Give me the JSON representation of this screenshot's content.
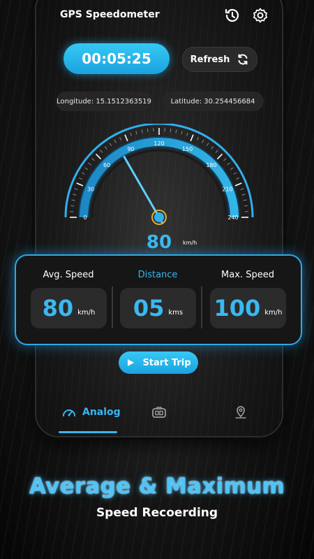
{
  "app": {
    "title": "GPS Speedometer"
  },
  "header": {
    "history_icon": "history-icon",
    "settings_icon": "gear-icon"
  },
  "timer": {
    "value": "00:05:25"
  },
  "refresh": {
    "label": "Refresh",
    "icon": "refresh-icon"
  },
  "location": {
    "longitude": "Longitude: 15.1512363519",
    "latitude": "Latitude: 30.254456684"
  },
  "gauge": {
    "ticks": [
      "0",
      "30",
      "60",
      "90",
      "120",
      "150",
      "180",
      "210",
      "240"
    ],
    "min": 0,
    "max": 240,
    "current_speed": 80,
    "speed_text": "80",
    "speed_unit": "km/h",
    "accent": "#2fb0ee"
  },
  "stats": {
    "avg": {
      "label": "Avg. Speed",
      "value": "80",
      "unit": "km/h"
    },
    "distance": {
      "label": "Distance",
      "value": "05",
      "unit": "kms"
    },
    "max": {
      "label": "Max. Speed",
      "value": "100",
      "unit": "km/h"
    }
  },
  "start_trip": {
    "label": "Start Trip",
    "icon": "play-icon"
  },
  "nav": {
    "analog": {
      "label": "Analog",
      "icon": "speedometer-icon"
    },
    "digital": {
      "icon": "digital-meter-icon"
    },
    "map": {
      "icon": "map-pin-icon"
    }
  },
  "promo": {
    "headline": "Average & Maximum",
    "subline": "Speed Recoerding"
  }
}
